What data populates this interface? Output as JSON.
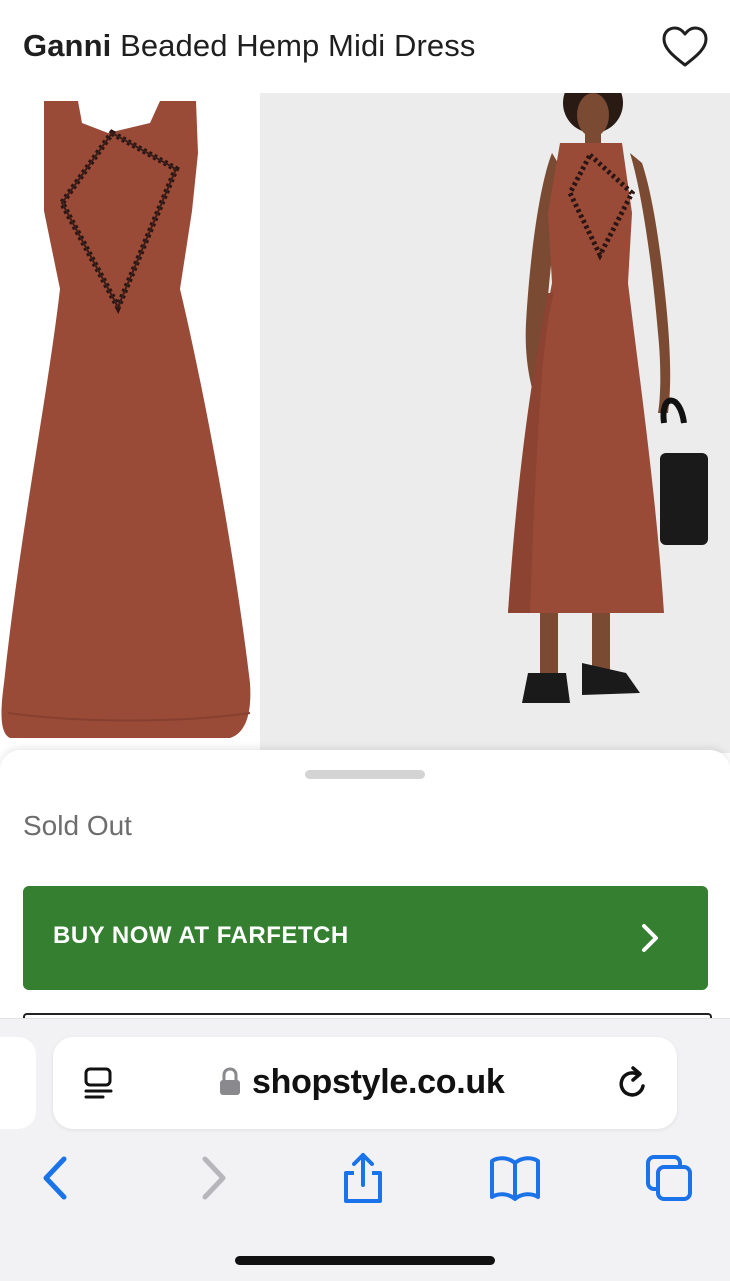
{
  "product": {
    "brand": "Ganni",
    "name": "Beaded Hemp Midi Dress",
    "status": "Sold Out",
    "cta_label": "BUY NOW AT FARFETCH"
  },
  "images": [
    {
      "alt": "Dress flat lay",
      "color": "#9a4b38"
    },
    {
      "alt": "Model wearing dress",
      "color": "#9a4b38"
    }
  ],
  "browser": {
    "url": "shopstyle.co.uk"
  },
  "icons": {
    "favorite": "heart-icon",
    "chevron": "chevron-right-icon",
    "reader": "reader-icon",
    "lock": "lock-icon",
    "reload": "reload-icon",
    "back": "back-icon",
    "forward": "forward-icon",
    "share": "share-icon",
    "bookmarks": "bookmarks-icon",
    "tabs": "tabs-icon"
  },
  "colors": {
    "cta": "#347f30",
    "accent": "#1a73e8",
    "dress": "#9a4b38"
  }
}
